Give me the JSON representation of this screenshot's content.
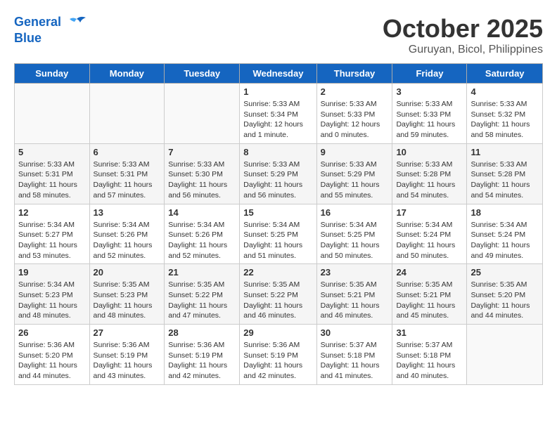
{
  "header": {
    "logo_line1": "General",
    "logo_line2": "Blue",
    "month": "October 2025",
    "location": "Guruyan, Bicol, Philippines"
  },
  "weekdays": [
    "Sunday",
    "Monday",
    "Tuesday",
    "Wednesday",
    "Thursday",
    "Friday",
    "Saturday"
  ],
  "weeks": [
    [
      {
        "day": "",
        "info": ""
      },
      {
        "day": "",
        "info": ""
      },
      {
        "day": "",
        "info": ""
      },
      {
        "day": "1",
        "info": "Sunrise: 5:33 AM\nSunset: 5:34 PM\nDaylight: 12 hours\nand 1 minute."
      },
      {
        "day": "2",
        "info": "Sunrise: 5:33 AM\nSunset: 5:33 PM\nDaylight: 12 hours\nand 0 minutes."
      },
      {
        "day": "3",
        "info": "Sunrise: 5:33 AM\nSunset: 5:33 PM\nDaylight: 11 hours\nand 59 minutes."
      },
      {
        "day": "4",
        "info": "Sunrise: 5:33 AM\nSunset: 5:32 PM\nDaylight: 11 hours\nand 58 minutes."
      }
    ],
    [
      {
        "day": "5",
        "info": "Sunrise: 5:33 AM\nSunset: 5:31 PM\nDaylight: 11 hours\nand 58 minutes."
      },
      {
        "day": "6",
        "info": "Sunrise: 5:33 AM\nSunset: 5:31 PM\nDaylight: 11 hours\nand 57 minutes."
      },
      {
        "day": "7",
        "info": "Sunrise: 5:33 AM\nSunset: 5:30 PM\nDaylight: 11 hours\nand 56 minutes."
      },
      {
        "day": "8",
        "info": "Sunrise: 5:33 AM\nSunset: 5:29 PM\nDaylight: 11 hours\nand 56 minutes."
      },
      {
        "day": "9",
        "info": "Sunrise: 5:33 AM\nSunset: 5:29 PM\nDaylight: 11 hours\nand 55 minutes."
      },
      {
        "day": "10",
        "info": "Sunrise: 5:33 AM\nSunset: 5:28 PM\nDaylight: 11 hours\nand 54 minutes."
      },
      {
        "day": "11",
        "info": "Sunrise: 5:33 AM\nSunset: 5:28 PM\nDaylight: 11 hours\nand 54 minutes."
      }
    ],
    [
      {
        "day": "12",
        "info": "Sunrise: 5:34 AM\nSunset: 5:27 PM\nDaylight: 11 hours\nand 53 minutes."
      },
      {
        "day": "13",
        "info": "Sunrise: 5:34 AM\nSunset: 5:26 PM\nDaylight: 11 hours\nand 52 minutes."
      },
      {
        "day": "14",
        "info": "Sunrise: 5:34 AM\nSunset: 5:26 PM\nDaylight: 11 hours\nand 52 minutes."
      },
      {
        "day": "15",
        "info": "Sunrise: 5:34 AM\nSunset: 5:25 PM\nDaylight: 11 hours\nand 51 minutes."
      },
      {
        "day": "16",
        "info": "Sunrise: 5:34 AM\nSunset: 5:25 PM\nDaylight: 11 hours\nand 50 minutes."
      },
      {
        "day": "17",
        "info": "Sunrise: 5:34 AM\nSunset: 5:24 PM\nDaylight: 11 hours\nand 50 minutes."
      },
      {
        "day": "18",
        "info": "Sunrise: 5:34 AM\nSunset: 5:24 PM\nDaylight: 11 hours\nand 49 minutes."
      }
    ],
    [
      {
        "day": "19",
        "info": "Sunrise: 5:34 AM\nSunset: 5:23 PM\nDaylight: 11 hours\nand 48 minutes."
      },
      {
        "day": "20",
        "info": "Sunrise: 5:35 AM\nSunset: 5:23 PM\nDaylight: 11 hours\nand 48 minutes."
      },
      {
        "day": "21",
        "info": "Sunrise: 5:35 AM\nSunset: 5:22 PM\nDaylight: 11 hours\nand 47 minutes."
      },
      {
        "day": "22",
        "info": "Sunrise: 5:35 AM\nSunset: 5:22 PM\nDaylight: 11 hours\nand 46 minutes."
      },
      {
        "day": "23",
        "info": "Sunrise: 5:35 AM\nSunset: 5:21 PM\nDaylight: 11 hours\nand 46 minutes."
      },
      {
        "day": "24",
        "info": "Sunrise: 5:35 AM\nSunset: 5:21 PM\nDaylight: 11 hours\nand 45 minutes."
      },
      {
        "day": "25",
        "info": "Sunrise: 5:35 AM\nSunset: 5:20 PM\nDaylight: 11 hours\nand 44 minutes."
      }
    ],
    [
      {
        "day": "26",
        "info": "Sunrise: 5:36 AM\nSunset: 5:20 PM\nDaylight: 11 hours\nand 44 minutes."
      },
      {
        "day": "27",
        "info": "Sunrise: 5:36 AM\nSunset: 5:19 PM\nDaylight: 11 hours\nand 43 minutes."
      },
      {
        "day": "28",
        "info": "Sunrise: 5:36 AM\nSunset: 5:19 PM\nDaylight: 11 hours\nand 42 minutes."
      },
      {
        "day": "29",
        "info": "Sunrise: 5:36 AM\nSunset: 5:19 PM\nDaylight: 11 hours\nand 42 minutes."
      },
      {
        "day": "30",
        "info": "Sunrise: 5:37 AM\nSunset: 5:18 PM\nDaylight: 11 hours\nand 41 minutes."
      },
      {
        "day": "31",
        "info": "Sunrise: 5:37 AM\nSunset: 5:18 PM\nDaylight: 11 hours\nand 40 minutes."
      },
      {
        "day": "",
        "info": ""
      }
    ]
  ]
}
